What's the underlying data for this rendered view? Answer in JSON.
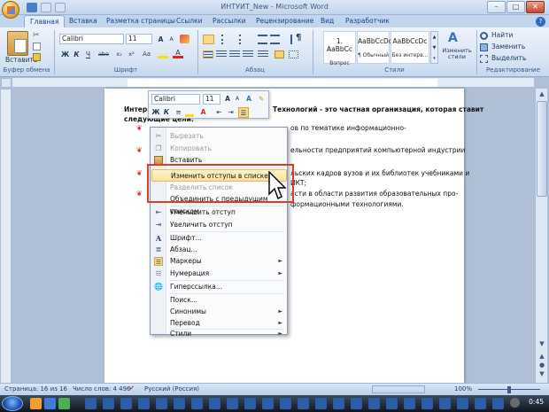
{
  "window": {
    "title": "ИНТУИТ_New - Microsoft Word",
    "minimize": "–",
    "maximize": "□",
    "close": "✕"
  },
  "tabs": [
    "Главная",
    "Вставка",
    "Разметка страницы",
    "Ссылки",
    "Рассылки",
    "Рецензирование",
    "Вид",
    "Разработчик"
  ],
  "ribbon": {
    "clipboard": {
      "paste_label": "Вставить",
      "group_label": "Буфер обмена"
    },
    "font": {
      "font_name": "Calibri",
      "font_size": "11",
      "grow": "A",
      "shrink": "A",
      "bold": "Ж",
      "italic": "К",
      "underline": "Ч",
      "strike": "abe",
      "subscript": "x₂",
      "superscript": "x²",
      "aa": "Aa",
      "group_label": "Шрифт"
    },
    "paragraph": {
      "group_label": "Абзац",
      "pilcrow": "¶"
    },
    "styles": {
      "items": [
        {
          "sample": "1. AaBbCc",
          "name": "Вопрос"
        },
        {
          "sample": "AaBbCcDc",
          "name": "¶ Обычный"
        },
        {
          "sample": "AaBbCcDc",
          "name": "Без интерв..."
        }
      ],
      "change_styles": "Изменить стили",
      "group_label": "Стили"
    },
    "editing": {
      "find": "Найти",
      "replace": "Заменить",
      "select": "Выделить",
      "group_label": "Редактирование"
    }
  },
  "document": {
    "heading_left": "Интерн",
    "heading_right": "Технологий - это частная организация, которая ставит",
    "heading_line2": "следующие цели:",
    "bullets": [
      {
        "left": "",
        "right": "ов по тематике информационно-"
      },
      {
        "left": "",
        "right": "ельности предприятий компьютерной индустрии"
      },
      {
        "left": "",
        "right": "льских кадров вузов и их библиотек учебниками и"
      },
      {
        "left": "",
        "right": "ИКТ;"
      },
      {
        "left": "",
        "right": "асти в области развития образовательных про-"
      },
      {
        "left": "",
        "right": "формационными технологиями."
      }
    ]
  },
  "minitoolbar": {
    "font_name": "Calibri",
    "font_size": "11",
    "bold": "Ж",
    "italic": "К"
  },
  "context_menu": {
    "items": [
      {
        "label": "Вырезать",
        "disabled": true,
        "icon": "scissors-icon"
      },
      {
        "label": "Копировать",
        "disabled": true,
        "icon": "copy-icon"
      },
      {
        "label": "Вставить",
        "disabled": false,
        "icon": "paste-icon"
      },
      {
        "label": "Изменить отступы в списке...",
        "disabled": false,
        "icon": ""
      },
      {
        "label": "Разделить список",
        "disabled": true,
        "icon": ""
      },
      {
        "label": "Объединить с предыдущим списком",
        "disabled": false,
        "icon": ""
      },
      {
        "label": "Уменьшить отступ",
        "disabled": false,
        "icon": "decrease-indent-icon"
      },
      {
        "label": "Увеличить отступ",
        "disabled": false,
        "icon": "increase-indent-icon"
      },
      {
        "label": "Шрифт...",
        "disabled": false,
        "icon": "font-icon"
      },
      {
        "label": "Абзац...",
        "disabled": false,
        "icon": "paragraph-icon"
      },
      {
        "label": "Маркеры",
        "disabled": false,
        "icon": "bullets-icon",
        "submenu": true
      },
      {
        "label": "Нумерация",
        "disabled": false,
        "icon": "numbering-icon",
        "submenu": true
      },
      {
        "label": "Гиперссылка...",
        "disabled": false,
        "icon": "hyperlink-icon"
      },
      {
        "label": "Поиск...",
        "disabled": false,
        "icon": "search-icon"
      },
      {
        "label": "Синонимы",
        "disabled": false,
        "icon": "",
        "submenu": true
      },
      {
        "label": "Перевод",
        "disabled": false,
        "icon": "",
        "submenu": true
      },
      {
        "label": "Стили",
        "disabled": false,
        "icon": "",
        "submenu": true
      }
    ],
    "highlighted_index": 3
  },
  "status_bar": {
    "page": "Страница: 16 из 16",
    "words": "Число слов: 4 496",
    "language": "Русский (Россия)",
    "zoom": "100%"
  },
  "taskbar": {
    "clock": "0:45"
  }
}
